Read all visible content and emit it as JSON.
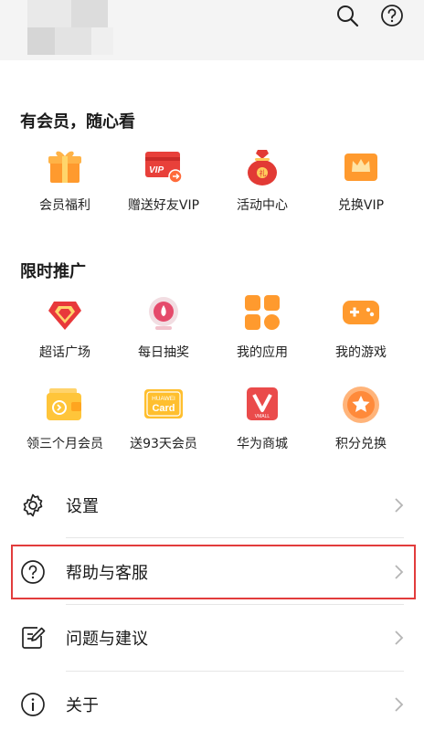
{
  "colors": {
    "accent": "#ff8a1f",
    "highlight": "#e23c3c",
    "chevron": "#b5b5b5"
  },
  "header": {
    "icons": [
      {
        "name": "search-icon"
      },
      {
        "name": "help-icon"
      }
    ]
  },
  "membership": {
    "title": "有会员，随心看",
    "items": [
      {
        "label": "会员福利",
        "icon": "gift-icon"
      },
      {
        "label": "赠送好友VIP",
        "icon": "vip-card-icon"
      },
      {
        "label": "活动中心",
        "icon": "lucky-bag-icon"
      },
      {
        "label": "兑换VIP",
        "icon": "crown-icon"
      }
    ]
  },
  "promo": {
    "title": "限时推广",
    "items": [
      {
        "label": "超话广场",
        "icon": "diamond-heart-icon"
      },
      {
        "label": "每日抽奖",
        "icon": "lottery-icon"
      },
      {
        "label": "我的应用",
        "icon": "apps-icon"
      },
      {
        "label": "我的游戏",
        "icon": "gamepad-icon"
      },
      {
        "label": "领三个月会员",
        "icon": "wallet-icon"
      },
      {
        "label": "送93天会员",
        "icon": "huawei-card-icon"
      },
      {
        "label": "华为商城",
        "icon": "vmall-icon"
      },
      {
        "label": "积分兑换",
        "icon": "star-points-icon"
      }
    ],
    "card_text": {
      "brand": "HUAWEI",
      "card": "Card",
      "vmall": "VMALL"
    }
  },
  "settings_list": [
    {
      "label": "设置",
      "icon": "gear-icon"
    },
    {
      "label": "帮助与客服",
      "icon": "question-circle-icon"
    },
    {
      "label": "问题与建议",
      "icon": "feedback-edit-icon"
    },
    {
      "label": "关于",
      "icon": "info-circle-icon"
    }
  ]
}
